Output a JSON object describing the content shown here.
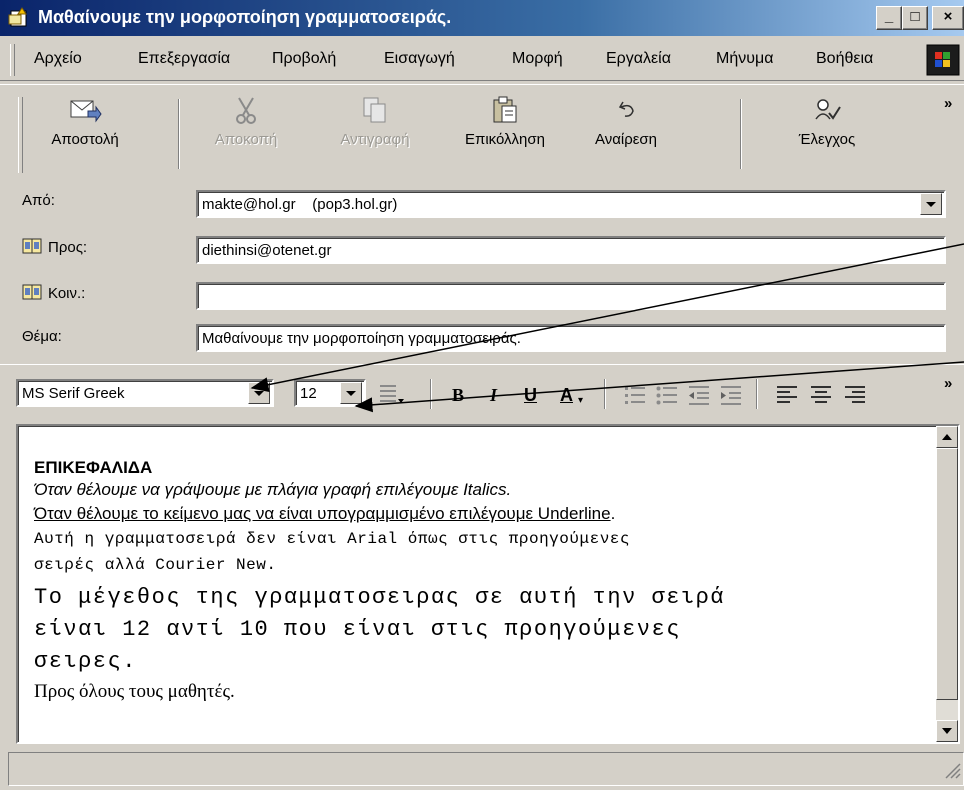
{
  "window": {
    "title": "Μαθαίνουμε την μορφοποίηση γραμματοσειράς.",
    "buttons": {
      "minimize": "_",
      "maximize": "□",
      "close": "×"
    }
  },
  "menu": {
    "items": [
      "Αρχείο",
      "Επεξεργασία",
      "Προβολή",
      "Εισαγωγή",
      "Μορφή",
      "Εργαλεία",
      "Μήνυμα",
      "Βοήθεια"
    ]
  },
  "toolbar": {
    "send": "Αποστολή",
    "cut": "Αποκοπή",
    "copy": "Αντιγραφή",
    "paste": "Επικόλληση",
    "undo": "Αναίρεση",
    "check": "Έλεγχος",
    "more": "»"
  },
  "header": {
    "from_label": "Από:",
    "from_value": "makte@hol.gr    (pop3.hol.gr)",
    "to_label": "Προς:",
    "to_value": "diethinsi@otenet.gr",
    "cc_label": "Κοιν.:",
    "cc_value": "",
    "subject_label": "Θέμα:",
    "subject_value": "Μαθαίνουμε την μορφοποίηση γραμματοσειράς."
  },
  "format": {
    "font": "MS Serif Greek",
    "size": "12",
    "bold": "B",
    "italic": "I",
    "underline": "U",
    "color": "A",
    "more": "»"
  },
  "body": {
    "heading": "ΕΠΙΚΕΦΑΛΙΔΑ",
    "line_italic": "Όταν θέλουμε να γράψουμε με πλάγια γραφή επιλέγουμε Italics.",
    "line_underline": "Όταν θέλουμε το κείμενο μας να είναι υπογραμμισμένο επιλέγουμε Underline",
    "line_underline_dot": ".",
    "line_courier_1": "Αυτή η γραμματοσειρά δεν είναι Arial όπως στις προηγούμενες",
    "line_courier_2": "σειρές αλλά Courier New.",
    "line_big_1": "Το μέγεθος της γραμματοσειρας σε αυτή την σειρά",
    "line_big_2": "είναι 12 αντί 10 που είναι στις προηγούμενες",
    "line_big_3": "σειρες.",
    "line_serif": "Προς όλους τους μαθητές."
  },
  "colors": {
    "title_bar_start": "#0a246a",
    "title_bar_end": "#a6caf0",
    "chrome": "#d4d0c8"
  }
}
